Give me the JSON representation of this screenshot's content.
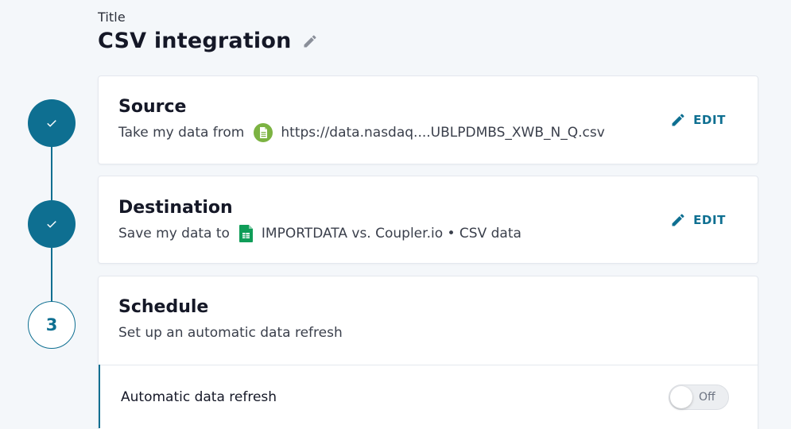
{
  "header": {
    "title_label": "Title",
    "title": "CSV integration"
  },
  "steps": [
    {
      "state": "done",
      "icon": "check-icon"
    },
    {
      "state": "done",
      "icon": "check-icon"
    },
    {
      "state": "current",
      "number": "3"
    }
  ],
  "source": {
    "title": "Source",
    "prefix": "Take my data from",
    "icon": "csv-file-icon",
    "value": "https://data.nasdaq....UBLPDMBS_XWB_N_Q.csv",
    "edit_label": "EDIT"
  },
  "destination": {
    "title": "Destination",
    "prefix": "Save my data to",
    "icon": "google-sheets-icon",
    "value": "IMPORTDATA vs. Coupler.io • CSV data",
    "edit_label": "EDIT"
  },
  "schedule": {
    "title": "Schedule",
    "subtitle": "Set up an automatic data refresh",
    "refresh_label": "Automatic data refresh",
    "toggle_label": "Off",
    "toggle_on": false
  },
  "colors": {
    "accent": "#0e6f91",
    "background": "#f4f7fa",
    "csv_icon": "#7cb342",
    "sheets_icon": "#0f9d58"
  }
}
